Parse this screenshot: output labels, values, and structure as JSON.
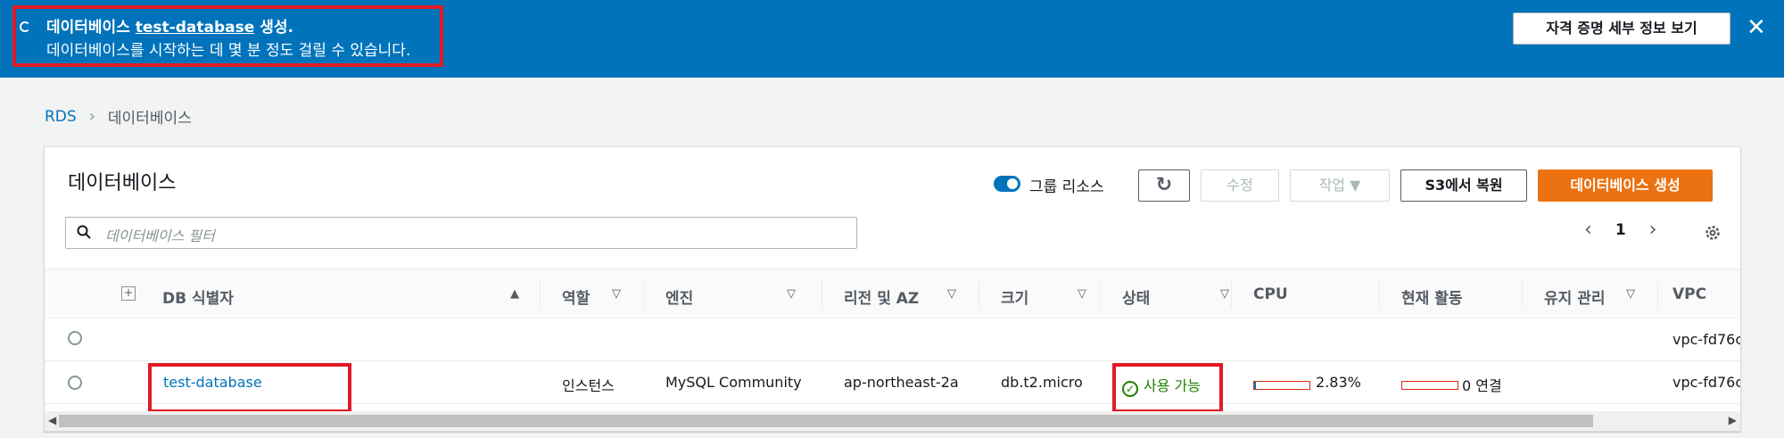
{
  "banner": {
    "title_prefix": "데이터베이스",
    "db_link": "test-database",
    "title_suffix": "생성.",
    "subtitle": "데이터베이스를 시작하는 데 몇 분 정도 걸릴 수 있습니다.",
    "details_button": "자격 증명 세부 정보 보기",
    "close": "✕"
  },
  "breadcrumb": {
    "root": "RDS",
    "current": "데이터베이스"
  },
  "panel": {
    "title": "데이터베이스",
    "group_toggle_label": "그룹 리소스",
    "refresh": "↻",
    "edit": "수정",
    "actions": "작업 ▼",
    "restore_s3": "S3에서 복원",
    "create": "데이터베이스 생성",
    "search_placeholder": "데이터베이스 필터",
    "page": "1"
  },
  "table": {
    "columns": {
      "id": "DB 식별자",
      "role": "역할",
      "engine": "엔진",
      "region": "리전 및 AZ",
      "size": "크기",
      "status": "상태",
      "cpu": "CPU",
      "activity": "현재 활동",
      "maintenance": "유지 관리",
      "vpc": "VPC"
    },
    "rows": [
      {
        "vpc": "vpc-fd76c"
      },
      {
        "id": "test-database",
        "role": "인스턴스",
        "engine": "MySQL Community",
        "region": "ap-northeast-2a",
        "size": "db.t2.micro",
        "status": "사용 가능",
        "cpu": "2.83%",
        "cpu_fraction": 0.0283,
        "activity": "0 연결",
        "vpc": "vpc-fd76c"
      }
    ]
  },
  "colors": {
    "accent": "#0073bb",
    "primary": "#ec7211",
    "ok": "#1d8102",
    "highlight": "#e01b24"
  }
}
